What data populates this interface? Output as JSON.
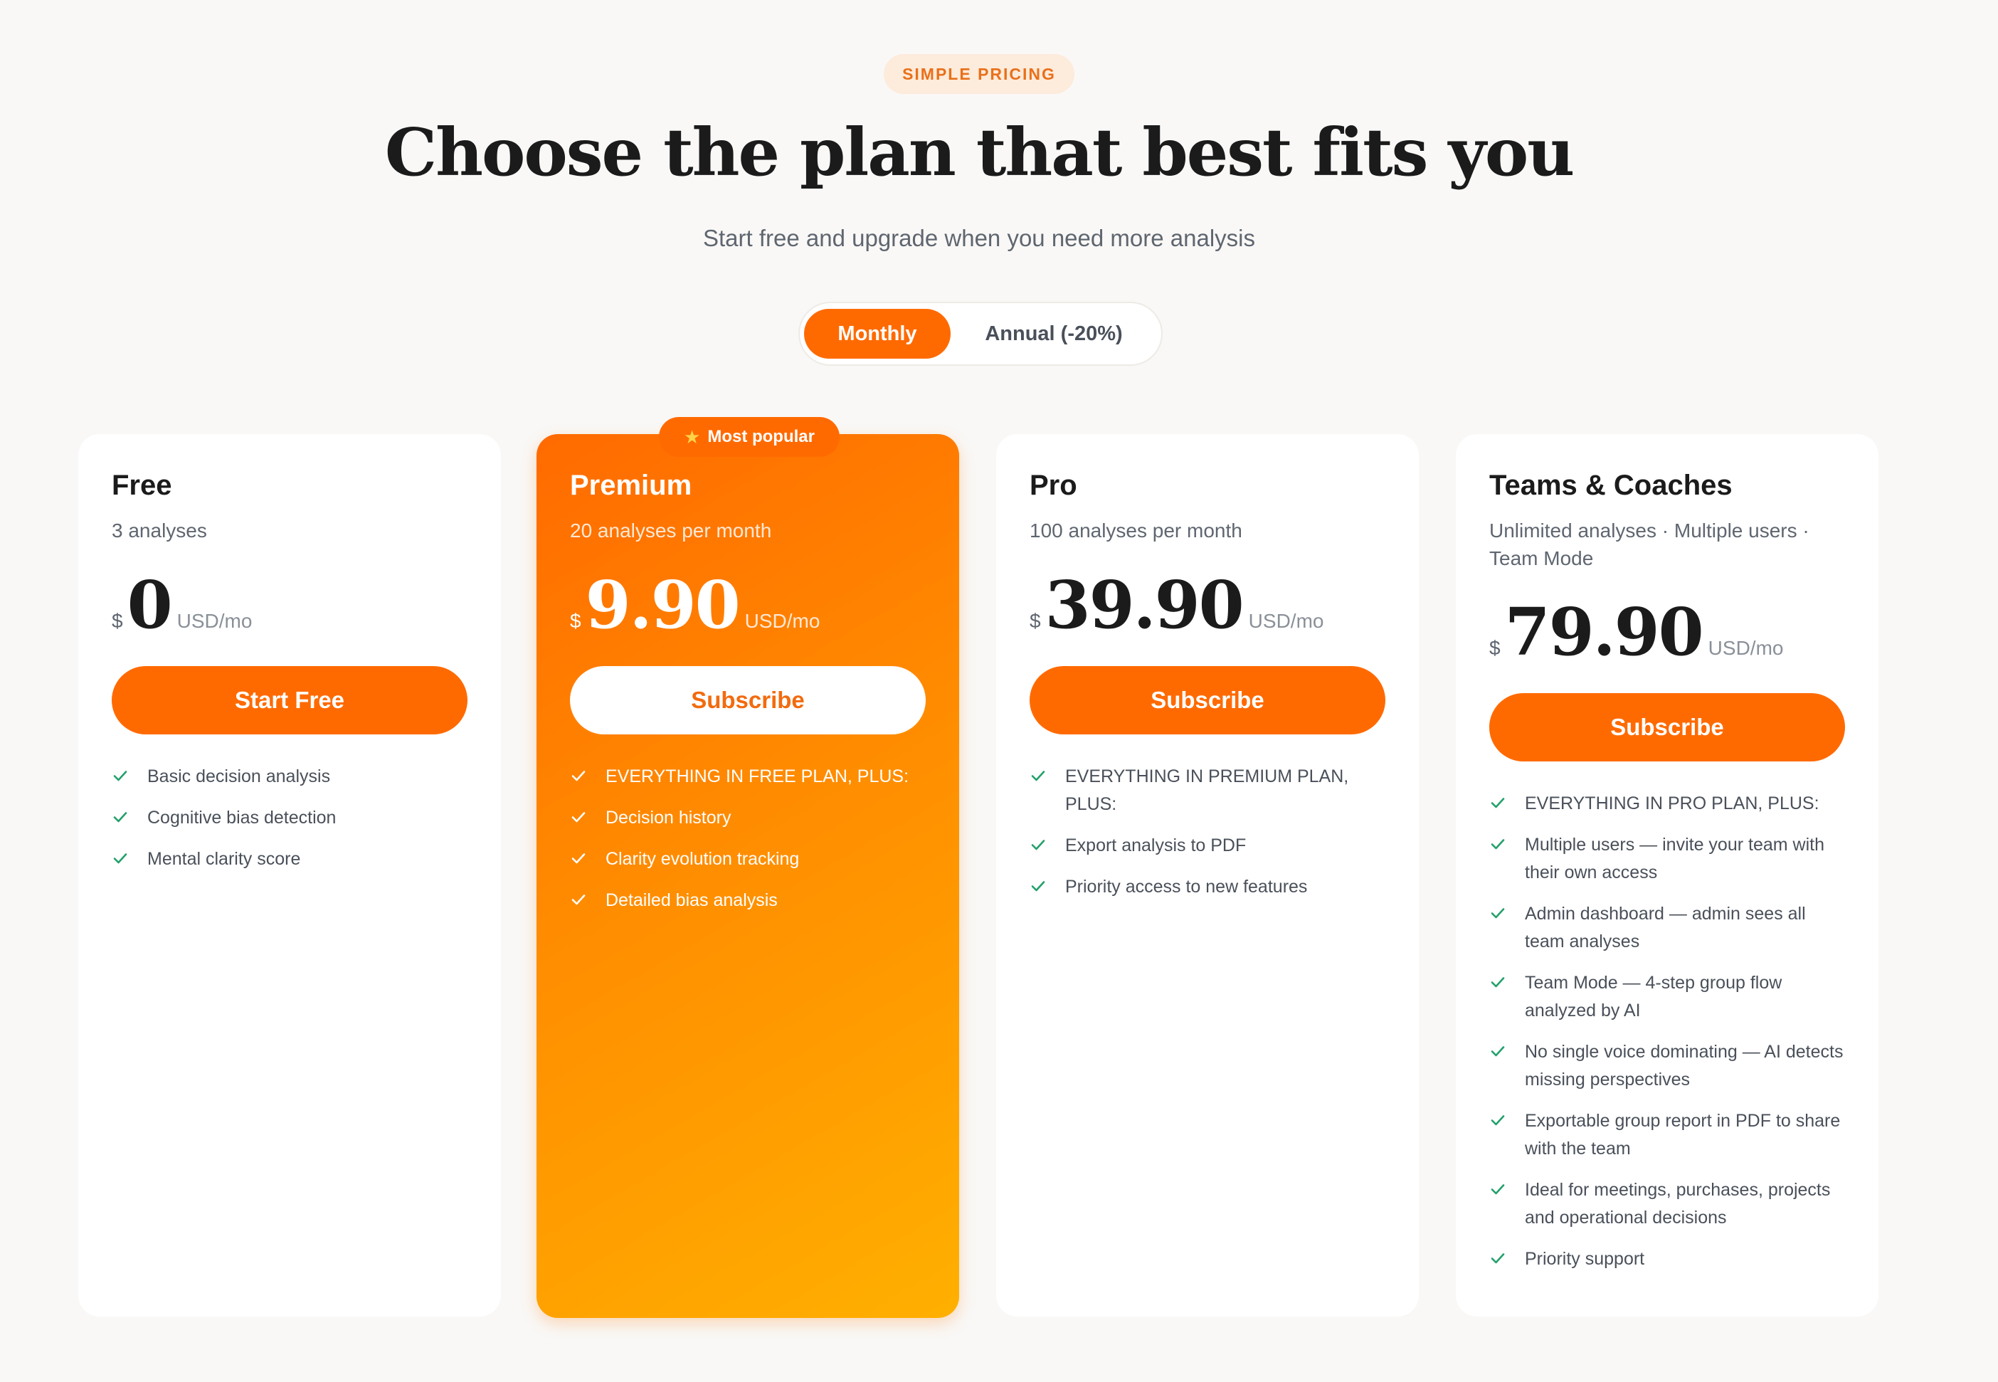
{
  "header": {
    "eyebrow": "SIMPLE PRICING",
    "title": "Choose the plan that best fits you",
    "subtitle": "Start free and upgrade when you need more analysis"
  },
  "billing_toggle": {
    "monthly": "Monthly",
    "annual": "Annual (-20%)",
    "selected": "Monthly"
  },
  "colors": {
    "accent": "#ff6a00",
    "check": "#22a06b",
    "background": "#f9f8f6"
  },
  "plans": [
    {
      "name": "Free",
      "description": "3 analyses",
      "currency": "$",
      "price": "0",
      "period": "USD/mo",
      "cta": "Start Free",
      "features": [
        "Basic decision analysis",
        "Cognitive bias detection",
        "Mental clarity score"
      ]
    },
    {
      "name": "Premium",
      "badge": "Most popular",
      "description": "20 analyses per month",
      "currency": "$",
      "price": "9.90",
      "period": "USD/mo",
      "cta": "Subscribe",
      "features": [
        "EVERYTHING IN FREE PLAN, PLUS:",
        "Decision history",
        "Clarity evolution tracking",
        "Detailed bias analysis"
      ]
    },
    {
      "name": "Pro",
      "description": "100 analyses per month",
      "currency": "$",
      "price": "39.90",
      "period": "USD/mo",
      "cta": "Subscribe",
      "features": [
        "EVERYTHING IN PREMIUM PLAN, PLUS:",
        "Export analysis to PDF",
        "Priority access to new features"
      ]
    },
    {
      "name": "Teams & Coaches",
      "description": "Unlimited analyses · Multiple users · Team Mode",
      "currency": "$",
      "price": "79.90",
      "period": "USD/mo",
      "cta": "Subscribe",
      "features": [
        "EVERYTHING IN PRO PLAN, PLUS:",
        "Multiple users — invite your team with their own access",
        "Admin dashboard — admin sees all team analyses",
        "Team Mode — 4-step group flow analyzed by AI",
        "No single voice dominating — AI detects missing perspectives",
        "Exportable group report in PDF to share with the team",
        "Ideal for meetings, purchases, projects and operational decisions",
        "Priority support"
      ]
    }
  ]
}
